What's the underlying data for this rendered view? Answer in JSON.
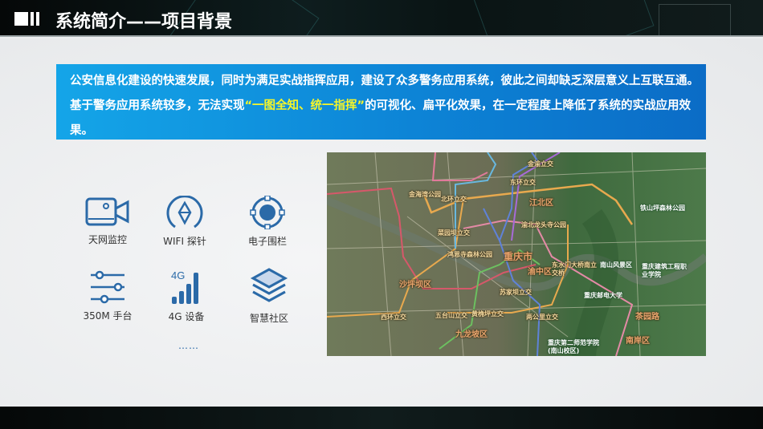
{
  "header": {
    "title": "系统简介——项目背景"
  },
  "intro": {
    "text_before": "公安信息化建设的快速发展，同时为满足实战指挥应用，建设了众多警务应用系统，彼此之间却缺乏深层意义上互联互通。基于警务应用系统较多，无法实现",
    "highlight": "“一图全知、统一指挥”",
    "text_after": "的可视化、扁平化效果，在一定程度上降低了系统的实战应用效果。"
  },
  "features": [
    {
      "label": "天网监控",
      "icon": "video-camera-icon"
    },
    {
      "label": "WIFI 探针",
      "icon": "wifi-probe-icon"
    },
    {
      "label": "电子围栏",
      "icon": "geofence-target-icon"
    },
    {
      "label": "350M 手台",
      "icon": "sliders-icon"
    },
    {
      "label": "4G 设备",
      "icon": "4g-signal-icon"
    },
    {
      "label": "智慧社区",
      "icon": "layers-icon"
    }
  ],
  "more": "……",
  "map": {
    "labels": {
      "city": "重庆市",
      "yuzhong": "渝中区",
      "jiangbei": "江北区",
      "nanan": "南岸区",
      "jiulongpo": "九龙坡区",
      "shapingba": "沙坪坝区",
      "nanshan": "南山风景区",
      "tieshanping": "铁山坪森林公园",
      "hongensi": "鸿恩寺森林公园",
      "jinhaiwan": "金海湾公园",
      "beihuan": "北环立交",
      "youdian": "重庆邮电大学",
      "wutaishan": "五台山立交",
      "xihuan": "西环立交",
      "sujiaba": "苏家坝立交",
      "chayuan": "茶园路",
      "jinyu": "金渝立交",
      "donghuan": "东环立交",
      "jianzhu": "重庆建筑工程职业学院",
      "longtousi": "渝北龙头寺公园",
      "huangjueping": "黄桷坪立交",
      "lianggong": "两公里立交",
      "caiyuanba": "菜园坝立交",
      "dongshuimen": "东水门大桥南立交桥",
      "dierbei": "重庆第二师范学院(南山校区)"
    }
  },
  "colors": {
    "accent": "#1d5f9f",
    "banner": "#0d84d6",
    "highlight": "#f5f52a"
  }
}
